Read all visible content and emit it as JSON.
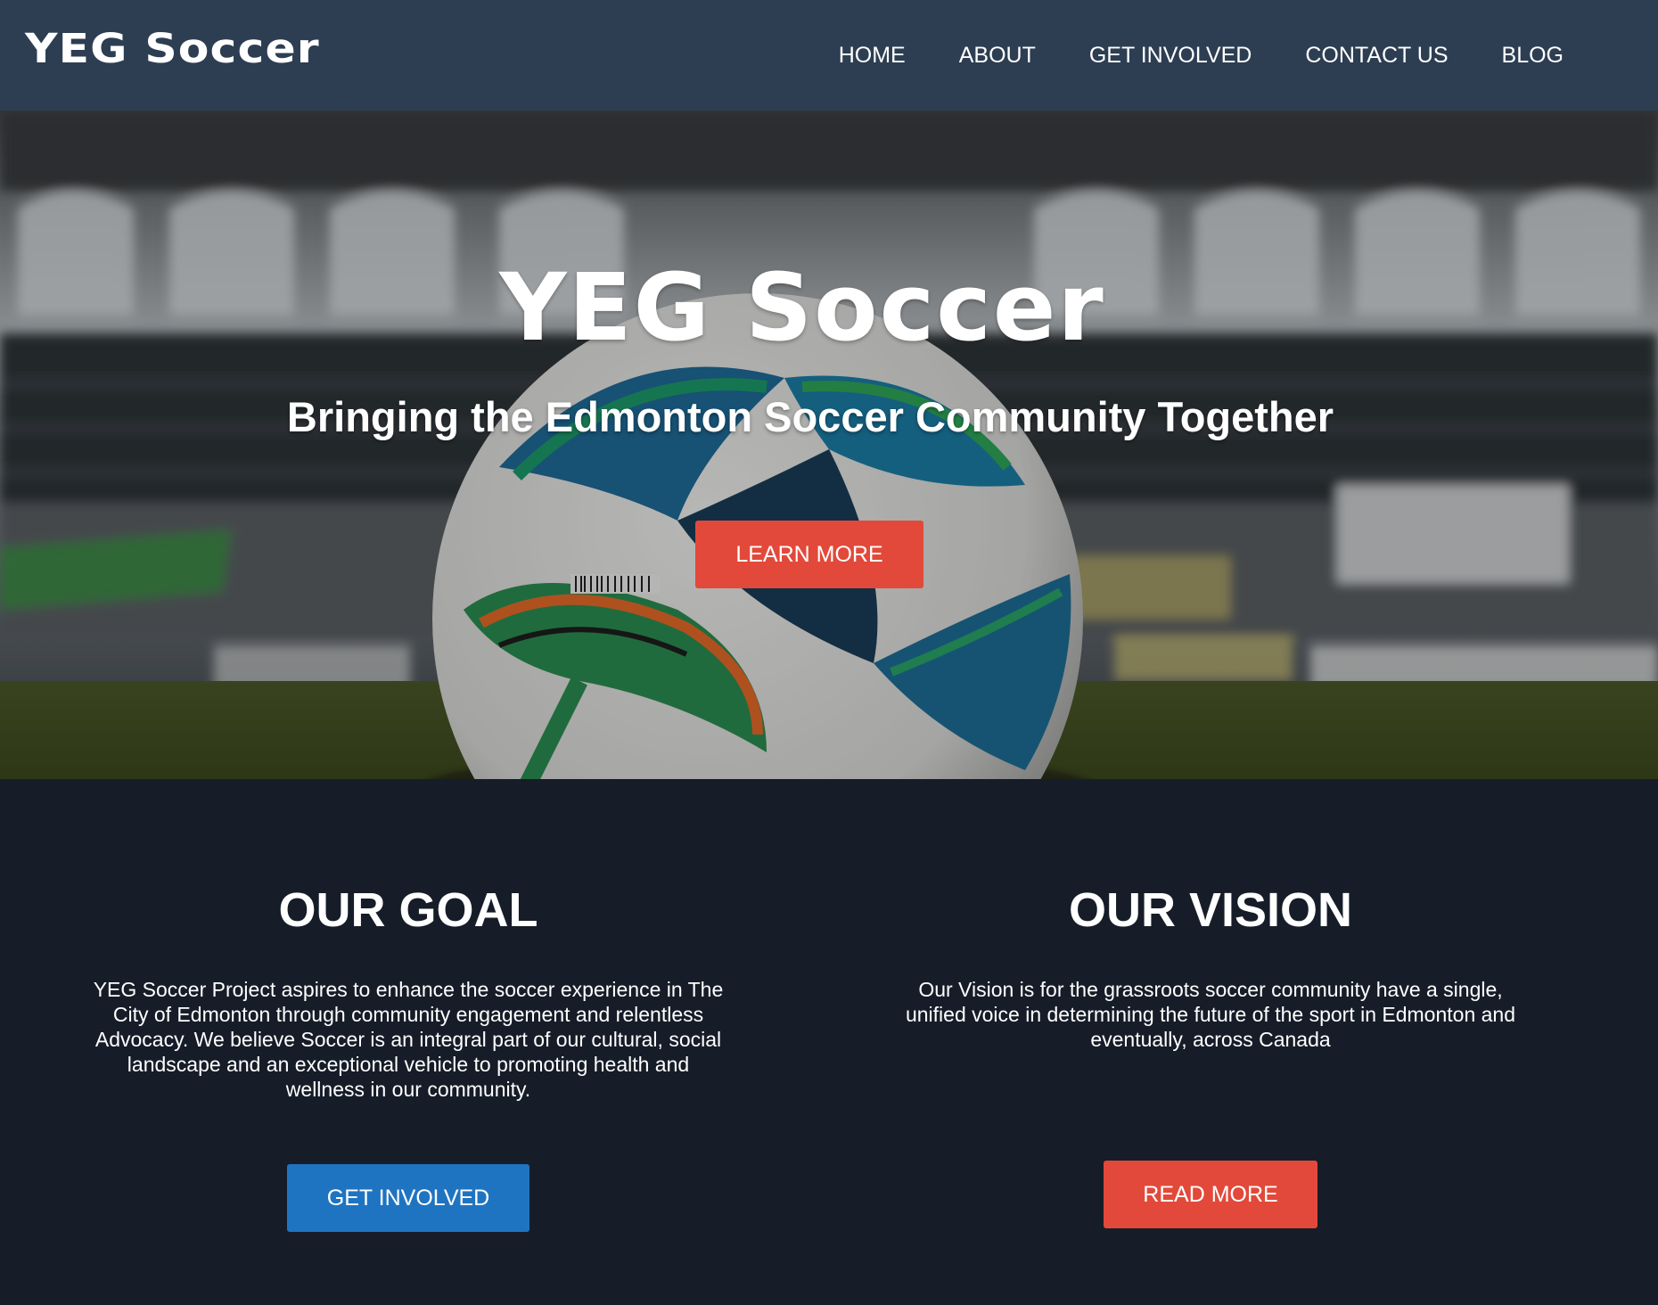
{
  "navbar": {
    "brand": "YEG Soccer",
    "links": [
      "HOME",
      "ABOUT",
      "GET INVOLVED",
      "CONTACT US",
      "BLOG"
    ]
  },
  "hero": {
    "title": "YEG Soccer",
    "subtitle": "Bringing the Edmonton Soccer Community Together",
    "button": "LEARN MORE",
    "background": "stadium-with-soccer-ball-photo"
  },
  "goal": {
    "heading": "OUR GOAL",
    "text": "YEG Soccer Project aspires to enhance the soccer experience in The City of Edmonton through community engagement and relentless Advocacy.  We believe Soccer is an integral part of our cultural, social landscape and an exceptional vehicle to promoting health and wellness in our community.",
    "button": "GET INVOLVED"
  },
  "vision": {
    "heading": "OUR VISION",
    "text": "Our Vision is for the grassroots soccer community have a single, unified voice in determining the future of the sport in Edmonton and eventually, across Canada",
    "button": "READ MORE"
  },
  "colors": {
    "navbar": "#2d3e53",
    "page": "#161d28",
    "red_button": "#e2493a",
    "blue_button": "#1f74c2"
  }
}
